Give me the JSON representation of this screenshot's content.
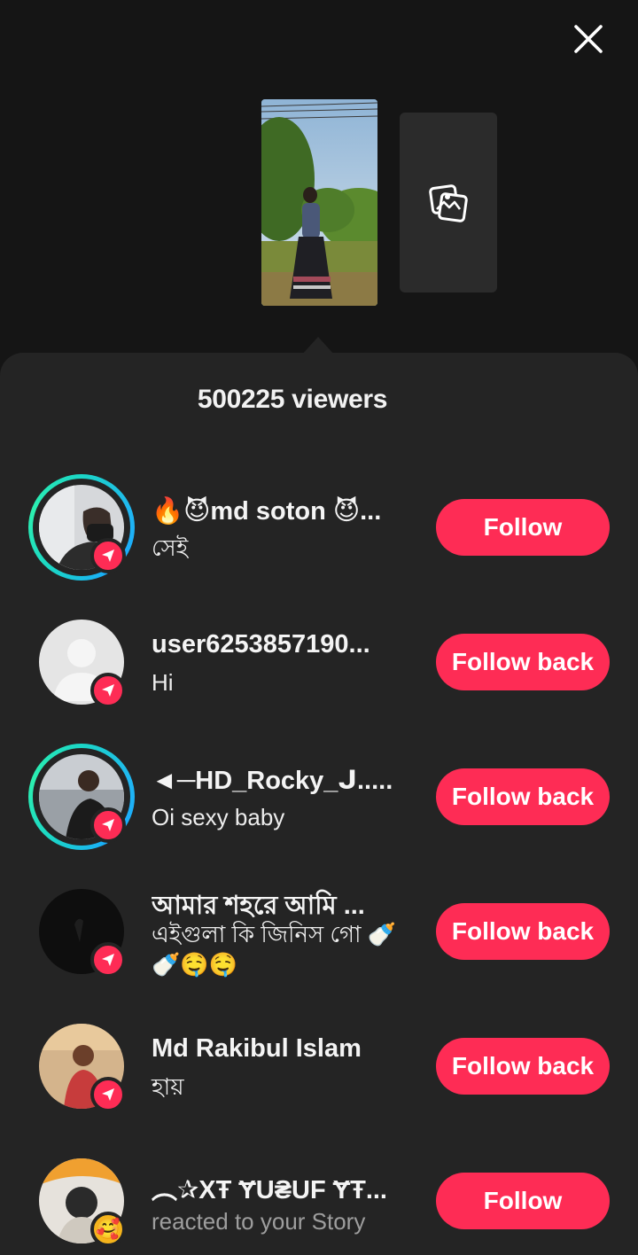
{
  "header": {
    "viewers_label": "500225 viewers",
    "close_icon": "close-icon",
    "gallery_icon": "photos-icon"
  },
  "colors": {
    "background": "#151515",
    "sheet": "#242424",
    "accent": "#fe2c55",
    "story_ring": "#1bd6c6"
  },
  "viewers": [
    {
      "name": "🔥😈md soton 😈...",
      "message": "সেই",
      "button": "Follow",
      "story_ring": true,
      "badge": "send-icon"
    },
    {
      "name": "user6253857190...",
      "message": "Hi",
      "button": "Follow back",
      "story_ring": false,
      "badge": "send-icon"
    },
    {
      "name": "◄─HD_Rocky_ᒍ.....",
      "message": "Oi sexy baby",
      "button": "Follow back",
      "story_ring": true,
      "badge": "send-icon"
    },
    {
      "name": "আমার শহরে আমি ...",
      "message": "এইগুলা কি জিনিস গো 🍼🍼🤤🤤",
      "button": "Follow back",
      "story_ring": false,
      "badge": "send-icon"
    },
    {
      "name": "Md Rakibul Islam",
      "message": "হায়",
      "button": "Follow back",
      "story_ring": false,
      "badge": "send-icon"
    },
    {
      "name": "︵✰XŦ ɎU₴UF ɎŦ...",
      "message": "reacted to your Story",
      "button": "Follow",
      "story_ring": false,
      "badge": "heart-eyes-emoji"
    }
  ]
}
